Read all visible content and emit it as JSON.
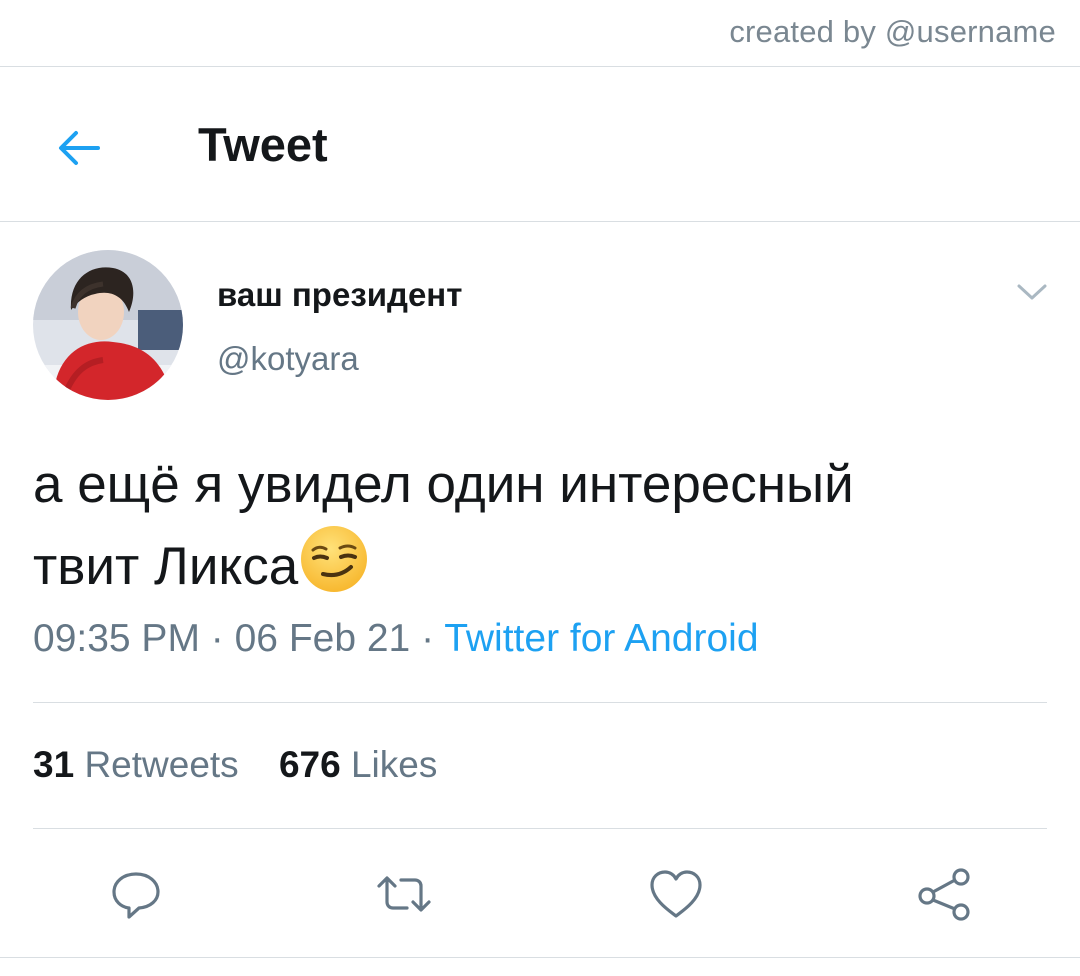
{
  "watermark": {
    "text": "created by @username"
  },
  "header": {
    "title": "Tweet",
    "back_icon": "arrow-left-icon",
    "accent": "#1da1f2"
  },
  "author": {
    "display_name": "ваш президент",
    "handle": "@kotyara",
    "avatar": "avatar-photo"
  },
  "tweet": {
    "lines": [
      "а ещё я увидел один интересный",
      "твит Ликса"
    ],
    "emoji": "smirking-face-emoji"
  },
  "meta": {
    "time": "09:35 PM",
    "sep1": " · ",
    "date": "06 Feb 21",
    "sep2": " · ",
    "source": "Twitter for Android"
  },
  "stats": {
    "retweets_count": "31",
    "retweets_label": "Retweets",
    "likes_count": "676",
    "likes_label": "Likes"
  },
  "actions": [
    "reply-icon",
    "retweet-icon",
    "like-icon",
    "share-icon"
  ],
  "colors": {
    "accent": "#1da1f2",
    "text": "#14171a",
    "muted": "#657786",
    "divider": "#d9dee2"
  }
}
